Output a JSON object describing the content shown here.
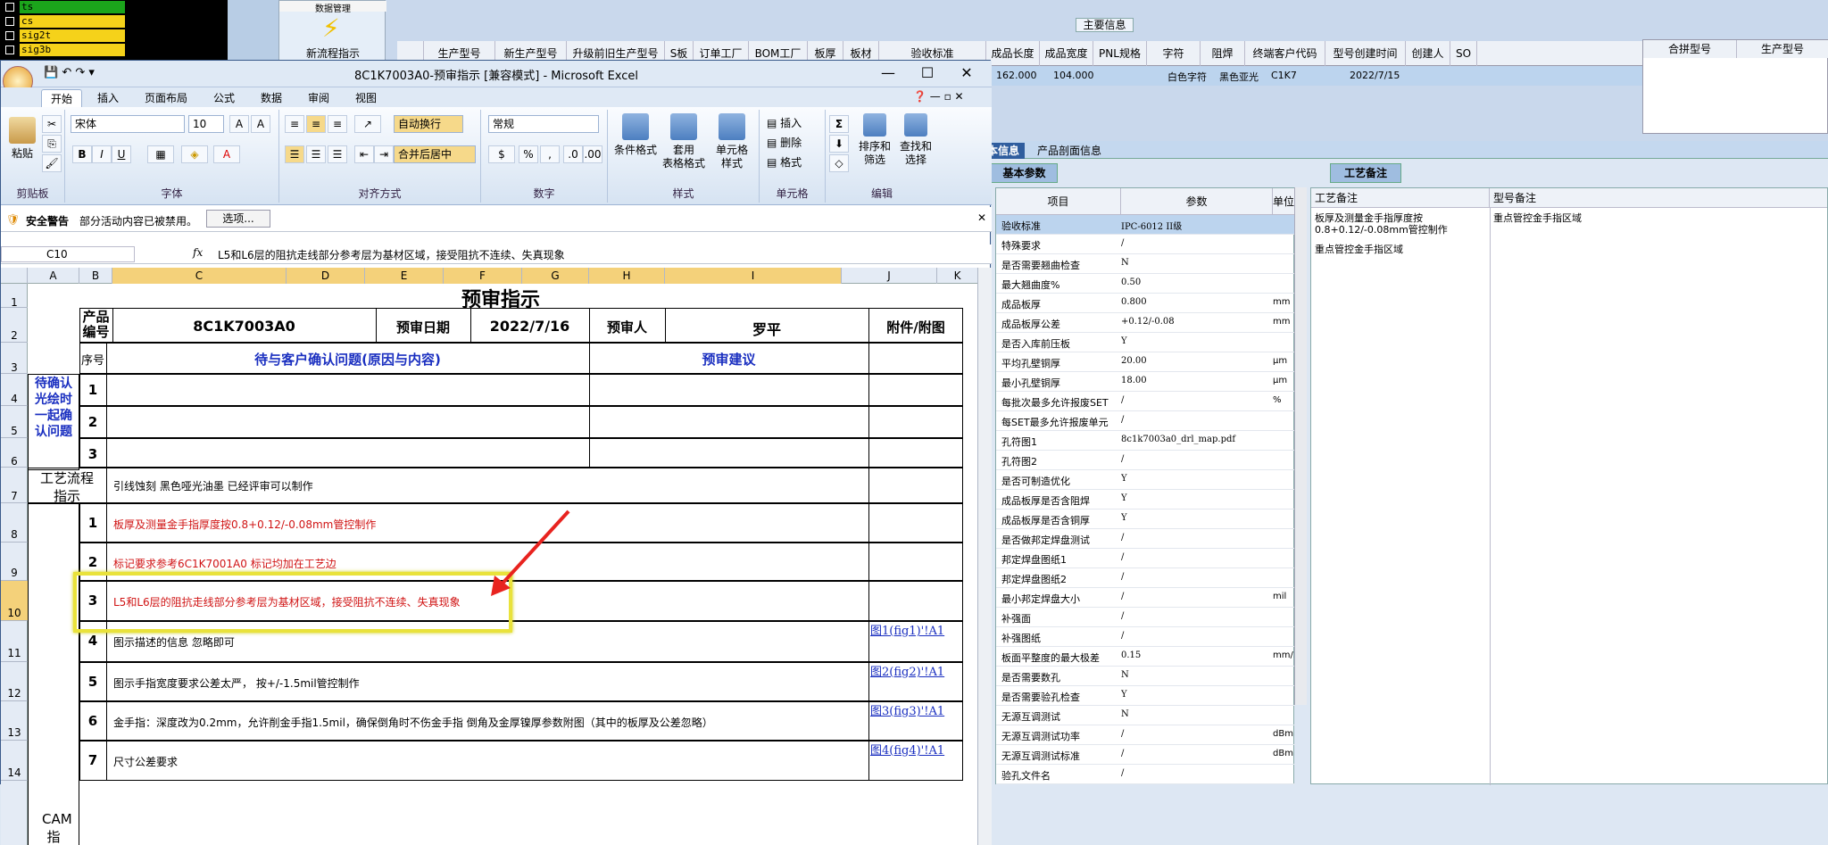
{
  "terminal": {
    "items": [
      "ts",
      "cs",
      "sig2t",
      "sig3b"
    ]
  },
  "background": {
    "tool_header": "数据管理",
    "tool_label": "新流程指示",
    "main_info": "主要信息",
    "columns": [
      "生产型号",
      "新生产型号",
      "升级前旧生产型号",
      "S板",
      "订单工厂",
      "BOM工厂",
      "板厚",
      "板材",
      "验收标准",
      "成品长度",
      "成品宽度",
      "PNL规格",
      "字符",
      "阻焊",
      "终端客户代码",
      "型号创建时间",
      "创建人",
      "SO"
    ],
    "row": {
      "length": "162.000",
      "width": "104.000",
      "char": "白色字符",
      "mask": "黑色亚光",
      "cust": "C1K7",
      "date": "2022/7/15"
    },
    "right_cols": [
      "合拼型号",
      "生产型号"
    ],
    "tabs": [
      "本信息",
      "产品剖面信息"
    ],
    "basic_tab": "基本参数",
    "craft_tab": "工艺备注",
    "param_headers": [
      "项目",
      "参数",
      "单位"
    ],
    "params": [
      [
        "验收标准",
        "IPC-6012 II级",
        ""
      ],
      [
        "特殊要求",
        "/",
        ""
      ],
      [
        "是否需要翘曲检查",
        "N",
        ""
      ],
      [
        "最大翘曲度%",
        "0.50",
        ""
      ],
      [
        "成品板厚",
        "0.800",
        "mm"
      ],
      [
        "成品板厚公差",
        "+0.12/-0.08",
        "mm"
      ],
      [
        "是否入库前压板",
        "Y",
        ""
      ],
      [
        "平均孔壁铜厚",
        "20.00",
        "μm"
      ],
      [
        "最小孔壁铜厚",
        "18.00",
        "μm"
      ],
      [
        "每批次最多允许报废SET",
        "/",
        "%"
      ],
      [
        "每SET最多允许报废单元",
        "/",
        ""
      ],
      [
        "孔符图1",
        "8c1k7003a0_drl_map.pdf",
        ""
      ],
      [
        "孔符图2",
        "/",
        ""
      ],
      [
        "是否可制造优化",
        "Y",
        ""
      ],
      [
        "成品板厚是否含阻焊",
        "Y",
        ""
      ],
      [
        "成品板厚是否含铜厚",
        "Y",
        ""
      ],
      [
        "是否做邦定焊盘测试",
        "/",
        ""
      ],
      [
        "邦定焊盘图纸1",
        "/",
        ""
      ],
      [
        "邦定焊盘图纸2",
        "/",
        ""
      ],
      [
        "最小邦定焊盘大小",
        "/",
        "mil"
      ],
      [
        "补强面",
        "/",
        ""
      ],
      [
        "补强图纸",
        "/",
        ""
      ],
      [
        "板面平整度的最大极差",
        "0.15",
        "mm/."
      ],
      [
        "是否需要数孔",
        "N",
        ""
      ],
      [
        "是否需要验孔检查",
        "Y",
        ""
      ],
      [
        "无源互调测试",
        "N",
        ""
      ],
      [
        "无源互调测试功率",
        "/",
        "dBm"
      ],
      [
        "无源互调测试标准",
        "/",
        "dBm"
      ],
      [
        "验孔文件名",
        "/",
        ""
      ]
    ],
    "craft_headers": [
      "工艺备注",
      "型号备注"
    ],
    "craft_note1": "板厚及测量金手指厚度按",
    "craft_note2": "0.8+0.12/-0.08mm管控制作",
    "craft_note3": "重点管控金手指区域",
    "model_note": "重点管控金手指区域"
  },
  "excel": {
    "title": "8C1K7003A0-预审指示  [兼容模式] - Microsoft Excel",
    "tabs": [
      "开始",
      "插入",
      "页面布局",
      "公式",
      "数据",
      "审阅",
      "视图"
    ],
    "font": "宋体",
    "size": "10",
    "wrap": "自动换行",
    "merge": "合并后居中",
    "numfmt": "常规",
    "groups": [
      "剪贴板",
      "字体",
      "对齐方式",
      "数字",
      "样式",
      "单元格",
      "编辑"
    ],
    "paste": "粘贴",
    "style_btns": [
      "条件格式",
      "套用\n表格格式",
      "单元格\n样式"
    ],
    "cell_btns": [
      "插入",
      "删除",
      "格式"
    ],
    "edit_btns": [
      "排序和\n筛选",
      "查找和\n选择"
    ],
    "security": "安全警告",
    "security_msg": "部分活动内容已被禁用。",
    "options": "选项...",
    "namebox": "C10",
    "formula": "L5和L6层的阻抗走线部分参考层为基材区域，接受阻抗不连续、失真现象",
    "cols": [
      "A",
      "B",
      "C",
      "D",
      "E",
      "F",
      "G",
      "H",
      "I",
      "J",
      "K"
    ],
    "rows": [
      "1",
      "2",
      "3",
      "4",
      "5",
      "6",
      "7",
      "8",
      "9",
      "10",
      "11",
      "12",
      "13",
      "14"
    ]
  },
  "sheet": {
    "title": "预审指示",
    "prod_label": "产品编号",
    "prod_no": "8C1K7003A0",
    "date_label": "预审日期",
    "date": "2022/7/16",
    "reviewer_label": "预审人",
    "reviewer": "罗平",
    "attach": "附件/附图",
    "seq": "序号",
    "q_header": "待与客户确认问题(原因与内容)",
    "advice": "预审建议",
    "pending": "待确认光绘时一起确认问题",
    "process_label": "工艺流程指示",
    "process_text": "引线蚀刻 黑色哑光油墨 已经评审可以制作",
    "cam": "CAM指示",
    "items": [
      {
        "n": "1",
        "text": "板厚及测量金手指厚度按0.8+0.12/-0.08mm管控制作",
        "link": ""
      },
      {
        "n": "2",
        "text": "标记要求参考6C1K7001A0   标记均加在工艺边",
        "link": ""
      },
      {
        "n": "3",
        "text": "L5和L6层的阻抗走线部分参考层为基材区域，接受阻抗不连续、失真现象",
        "link": ""
      },
      {
        "n": "4",
        "text": "图示描述的信息  忽略即可",
        "link": "图1(fig1)'!A1"
      },
      {
        "n": "5",
        "text": "图示手指宽度要求公差太严，  按+/-1.5mil管控制作",
        "link": "图2(fig2)'!A1"
      },
      {
        "n": "6",
        "text": "金手指：深度改为0.2mm，允许削金手指1.5mil，确保倒角时不伤金手指   倒角及金厚镍厚参数附图（其中的板厚及公差忽略）",
        "link": "图3(fig3)'!A1"
      },
      {
        "n": "7",
        "text": "尺寸公差要求",
        "link": "图4(fig4)'!A1"
      }
    ],
    "pending_rows": [
      "1",
      "2",
      "3"
    ]
  }
}
